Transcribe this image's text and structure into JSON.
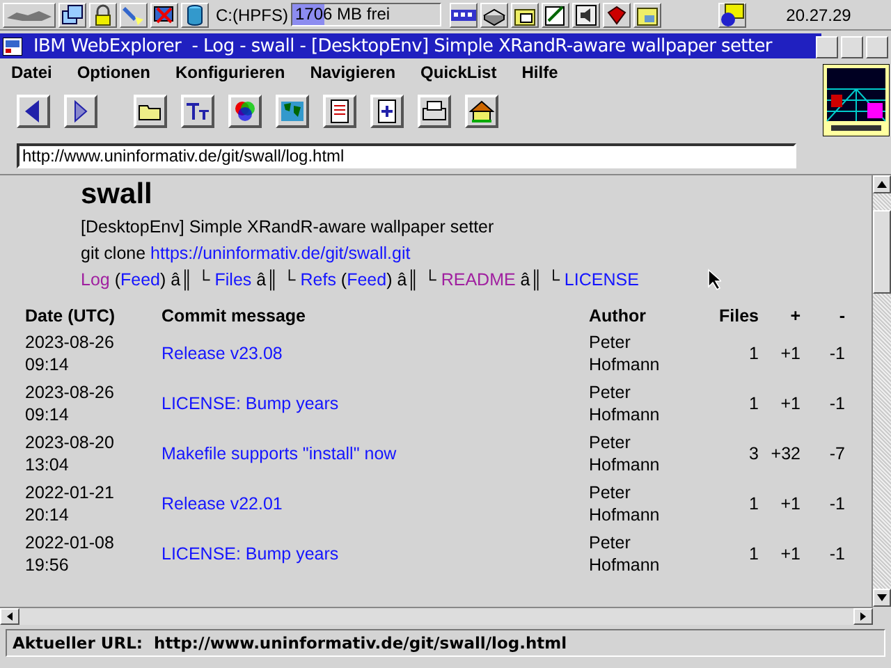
{
  "taskbar": {
    "drive": "C:(HPFS)",
    "disk_space": {
      "label": "1706 MB frei",
      "level": 0.22
    },
    "clock": "20.27.29"
  },
  "window": {
    "title": "IBM WebExplorer  - Log - swall - [DesktopEnv] Simple XRandR-aware wallpaper setter"
  },
  "menu": [
    "Datei",
    "Optionen",
    "Konfigurieren",
    "Navigieren",
    "QuickList",
    "Hilfe"
  ],
  "address": {
    "value": "http://www.uninformativ.de/git/swall/log.html"
  },
  "page": {
    "heading": "swall",
    "description": "[DesktopEnv] Simple XRandR-aware wallpaper setter",
    "clone_label": "git clone",
    "clone_url": "https://uninformativ.de/git/swall.git",
    "nav": [
      {
        "kind": "link",
        "text": "Log",
        "visited": true
      },
      {
        "kind": "text",
        "text": " ("
      },
      {
        "kind": "link",
        "text": "Feed",
        "visited": false
      },
      {
        "kind": "text",
        "text": ") â║ └ "
      },
      {
        "kind": "link",
        "text": "Files",
        "visited": false
      },
      {
        "kind": "text",
        "text": " â║ └ "
      },
      {
        "kind": "link",
        "text": "Refs",
        "visited": false
      },
      {
        "kind": "text",
        "text": " ("
      },
      {
        "kind": "link",
        "text": "Feed",
        "visited": false
      },
      {
        "kind": "text",
        "text": ") â║ └ "
      },
      {
        "kind": "link",
        "text": "README",
        "visited": true
      },
      {
        "kind": "text",
        "text": " â║ └ "
      },
      {
        "kind": "link",
        "text": "LICENSE",
        "visited": false
      }
    ],
    "table": {
      "columns": [
        "Date (UTC)",
        "Commit message",
        "Author",
        "Files",
        "+",
        "-"
      ],
      "rows": [
        {
          "date": "2023-08-26",
          "time": "09:14",
          "message": "Release v23.08",
          "author": "Peter Hofmann",
          "files": "1",
          "plus": "+1",
          "minus": "-1"
        },
        {
          "date": "2023-08-26",
          "time": "09:14",
          "message": "LICENSE: Bump years",
          "author": "Peter Hofmann",
          "files": "1",
          "plus": "+1",
          "minus": "-1"
        },
        {
          "date": "2023-08-20",
          "time": "13:04",
          "message": "Makefile supports \"install\" now",
          "author": "Peter Hofmann",
          "files": "3",
          "plus": "+32",
          "minus": "-7"
        },
        {
          "date": "2022-01-21",
          "time": "20:14",
          "message": "Release v22.01",
          "author": "Peter Hofmann",
          "files": "1",
          "plus": "+1",
          "minus": "-1"
        },
        {
          "date": "2022-01-08",
          "time": "19:56",
          "message": "LICENSE: Bump years",
          "author": "Peter Hofmann",
          "files": "1",
          "plus": "+1",
          "minus": "-1"
        }
      ]
    }
  },
  "status_bar": "Aktueller URL:  http://www.uninformativ.de/git/swall/log.html"
}
